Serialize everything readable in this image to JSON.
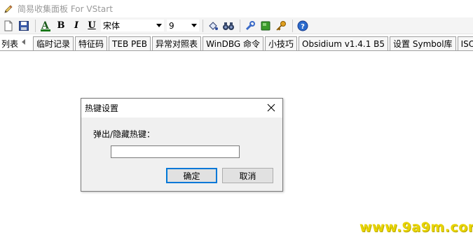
{
  "window": {
    "title": "简易收集面板 For VStart",
    "app_icon": "pencil-icon"
  },
  "toolbar": {
    "font_name": "宋体",
    "font_size": "9",
    "bold_label": "B",
    "italic_label": "I",
    "underline_label": "U",
    "font_color_label": "A",
    "colors": {
      "font_color": "#1a7a1a",
      "green_square": "#3a9a2a",
      "help": "#2a6acc"
    }
  },
  "tabstrip": {
    "list_label": "列表",
    "tabs": [
      {
        "label": "临时记录"
      },
      {
        "label": "特征码"
      },
      {
        "label": "TEB PEB"
      },
      {
        "label": "异常对照表"
      },
      {
        "label": "WinDBG 命令"
      },
      {
        "label": "小技巧"
      },
      {
        "label": "Obsidium v1.4.1 B5"
      },
      {
        "label": "设置 Symbol库"
      },
      {
        "label": "ISO ANSI"
      }
    ]
  },
  "dialog": {
    "title": "热键设置",
    "label": "弹出/隐藏热键：",
    "input_value": "",
    "ok_label": "确定",
    "cancel_label": "取消"
  },
  "watermark": {
    "text": "www.9a9m.com"
  }
}
